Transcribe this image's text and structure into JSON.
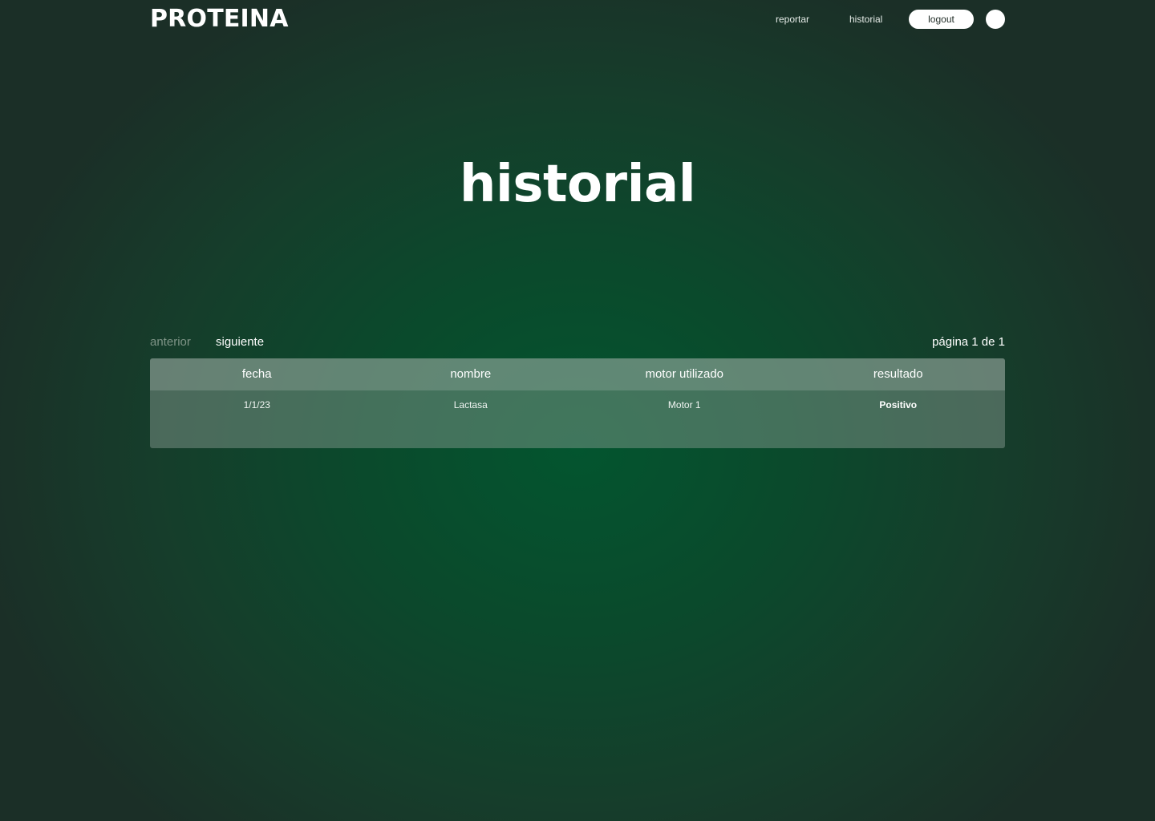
{
  "brand": {
    "logo_text": "PROTEINA"
  },
  "nav": {
    "report_label": "reportar",
    "history_label": "historial",
    "logout_label": "logout",
    "avatar_icon": "user-avatar-icon"
  },
  "main": {
    "title": "historial"
  },
  "pagination": {
    "prev_label": "anterior",
    "next_label": "siguiente",
    "page_info": "página 1 de 1"
  },
  "table": {
    "columns": [
      "fecha",
      "nombre",
      "motor utilizado",
      "resultado"
    ],
    "rows": [
      {
        "fecha": "1/1/23",
        "nombre": "Lactasa",
        "motor": "Motor 1",
        "resultado": "Positivo"
      }
    ]
  },
  "colors": {
    "background_center": "#03552f",
    "background_edge": "#1b2f27",
    "table_bg": "#5f7a6a",
    "text": "#ffffff",
    "muted_text": "#7f9487"
  }
}
